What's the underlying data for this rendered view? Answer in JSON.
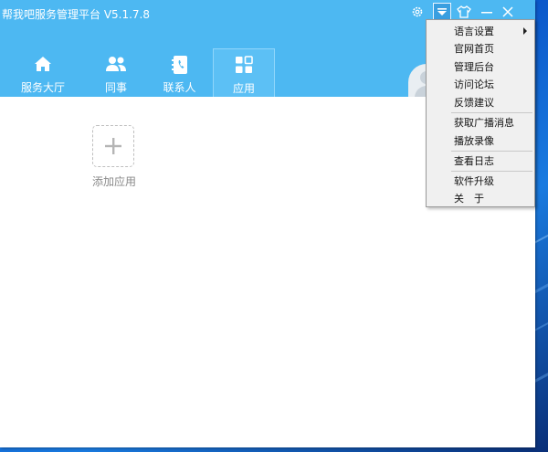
{
  "window": {
    "title": "帮我吧服务管理平台 V5.1.7.8",
    "controls": {
      "settings": "gear-icon",
      "menu": "dropdown-icon",
      "skin": "shirt-icon",
      "minimize": "minimize-icon",
      "close": "close-icon"
    }
  },
  "nav": {
    "tabs": [
      {
        "label": "服务大厅",
        "icon": "home-icon"
      },
      {
        "label": "同事",
        "icon": "people-icon"
      },
      {
        "label": "联系人",
        "icon": "contacts-book-icon"
      },
      {
        "label": "应用",
        "icon": "apps-grid-icon",
        "active": true
      }
    ]
  },
  "content": {
    "add_app": {
      "icon": "plus-icon",
      "label": "添加应用"
    }
  },
  "menu": {
    "items": [
      {
        "label": "语言设置",
        "submenu": true
      },
      {
        "label": "官网首页"
      },
      {
        "label": "管理后台"
      },
      {
        "label": "访问论坛"
      },
      {
        "label": "反馈建议"
      },
      {
        "label": "获取广播消息"
      },
      {
        "label": "播放录像"
      },
      {
        "label": "查看日志"
      },
      {
        "label": "软件升级"
      },
      {
        "label": "关　于"
      }
    ]
  },
  "colors": {
    "accent": "#4db8f2",
    "active_tab": "#5cc0f5",
    "menu_bg": "#f0f0f0"
  }
}
